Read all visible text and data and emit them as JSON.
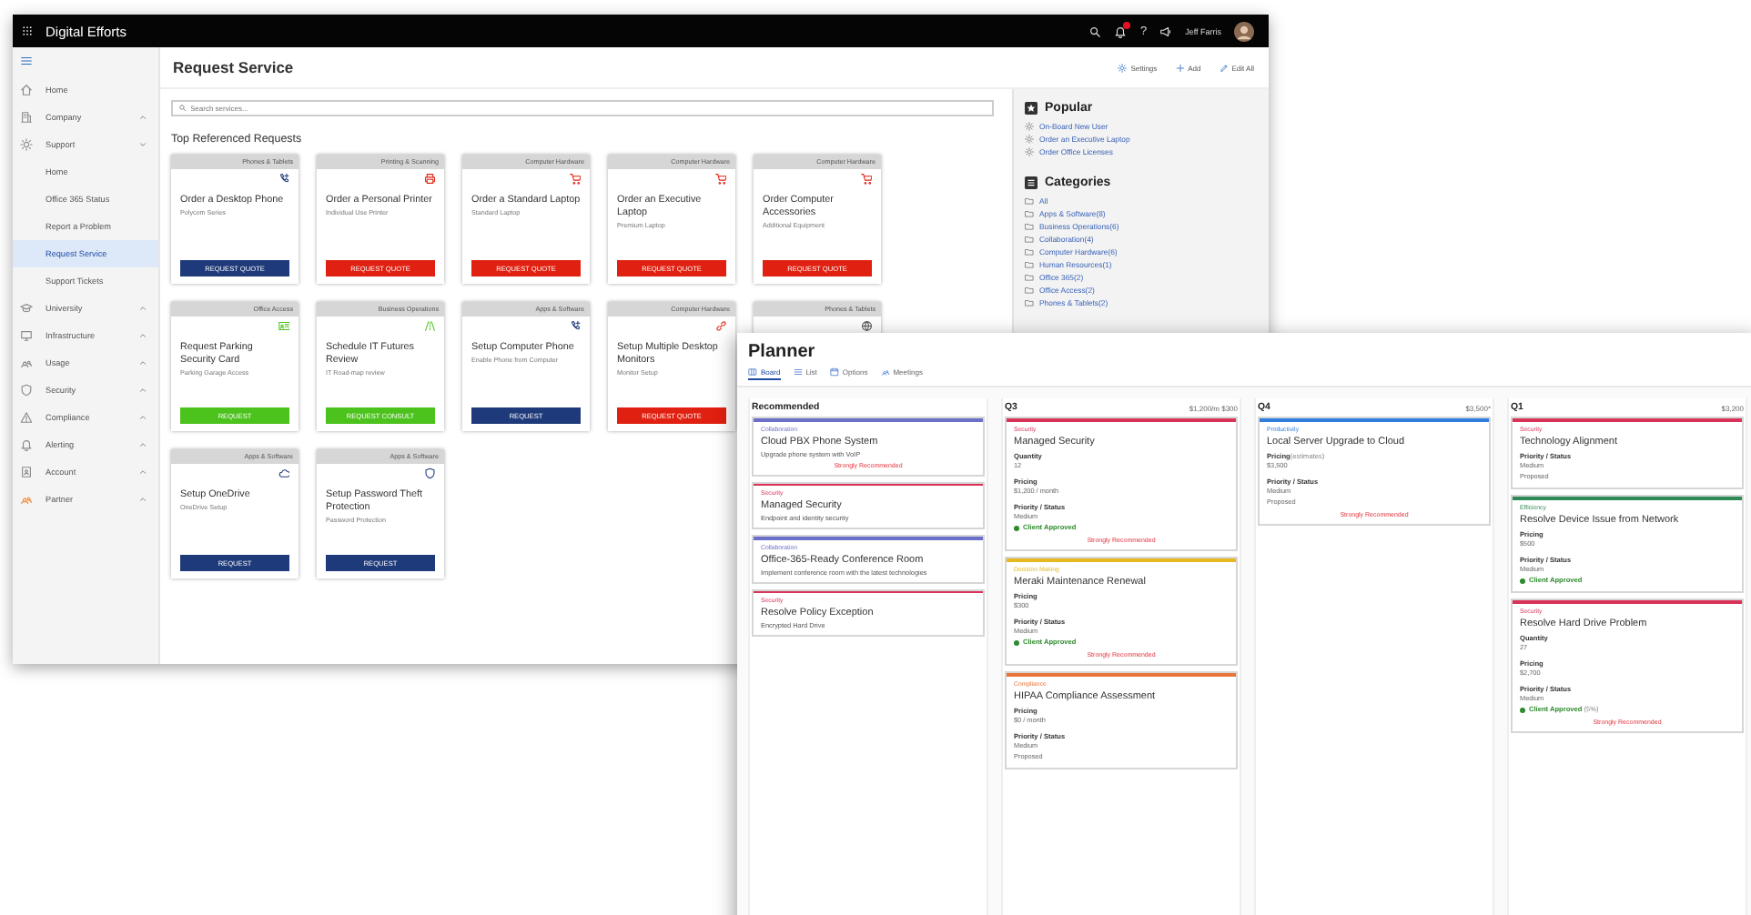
{
  "app": {
    "title": "Digital Efforts",
    "has_unread": true,
    "help": "?",
    "user": "Jeff Farris"
  },
  "sidebar": {
    "items": [
      {
        "label": "Home"
      },
      {
        "label": "Company",
        "expanded": false
      },
      {
        "label": "Support",
        "expanded": true,
        "children": [
          {
            "label": "Home",
            "selected": false
          },
          {
            "label": "Office 365 Status",
            "selected": false
          },
          {
            "label": "Report a Problem",
            "selected": false
          },
          {
            "label": "Request Service",
            "selected": true
          },
          {
            "label": "Support Tickets",
            "selected": false
          }
        ]
      },
      {
        "label": "University",
        "expanded": false
      },
      {
        "label": "Infrastructure",
        "expanded": false
      },
      {
        "label": "Usage",
        "expanded": false
      },
      {
        "label": "Security",
        "expanded": false
      },
      {
        "label": "Compliance",
        "expanded": false
      },
      {
        "label": "Alerting",
        "expanded": false
      },
      {
        "label": "Account",
        "expanded": false
      },
      {
        "label": "Partner",
        "expanded": false
      }
    ]
  },
  "main": {
    "title": "Request Service",
    "actions": [
      {
        "label": "Settings"
      },
      {
        "label": "Add"
      },
      {
        "label": "Edit All"
      }
    ],
    "search": {
      "placeholder": "Search services..."
    },
    "section_title": "Top Referenced Requests",
    "cards": [
      {
        "category": "Phones & Tablets",
        "title": "Order a Desktop Phone",
        "subtitle": "Polycom Series",
        "button": "REQUEST QUOTE",
        "color": "#1f3a7a"
      },
      {
        "category": "Printing & Scanning",
        "title": "Order a Personal Printer",
        "subtitle": "Individual Use Printer",
        "button": "REQUEST QUOTE",
        "color": "#e02010"
      },
      {
        "category": "Computer Hardware",
        "title": "Order a Standard Laptop",
        "subtitle": "Standard Laptop",
        "button": "REQUEST QUOTE",
        "color": "#e02010"
      },
      {
        "category": "Computer Hardware",
        "title": "Order an Executive Laptop",
        "subtitle": "Premium Laptop",
        "button": "REQUEST QUOTE",
        "color": "#e02010"
      },
      {
        "category": "Computer Hardware",
        "title": "Order Computer Accessories",
        "subtitle": "Additional Equipment",
        "button": "REQUEST QUOTE",
        "color": "#e02010"
      },
      {
        "category": "Office Access",
        "title": "Request Parking Security Card",
        "subtitle": "Parking Garage Access",
        "button": "REQUEST",
        "color": "#4cc21c"
      },
      {
        "category": "Business Operations",
        "title": "Schedule IT Futures Review",
        "subtitle": "IT Road-map review",
        "button": "REQUEST CONSULT",
        "color": "#4cc21c"
      },
      {
        "category": "Apps & Software",
        "title": "Setup Computer Phone",
        "subtitle": "Enable Phone from Computer",
        "button": "REQUEST",
        "color": "#1f3a7a"
      },
      {
        "category": "Computer Hardware",
        "title": "Setup Multiple Desktop Monitors",
        "subtitle": "Monitor Setup",
        "button": "REQUEST QUOTE",
        "color": "#e02010"
      },
      {
        "category": "Phones & Tablets"
      },
      {
        "category": "Apps & Software",
        "title": "Setup OneDrive",
        "subtitle": "OneDrive Setup",
        "button": "REQUEST",
        "color": "#1f3a7a"
      },
      {
        "category": "Apps & Software",
        "title": "Setup Password Theft Protection",
        "subtitle": "Password Protection",
        "button": "REQUEST",
        "color": "#1f3a7a"
      }
    ]
  },
  "aside": {
    "popular": {
      "title": "Popular",
      "items": [
        "On-Board New User",
        "Order an Executive Laptop",
        "Order Office Licenses"
      ]
    },
    "categories": {
      "title": "Categories",
      "items": [
        {
          "label": "All"
        },
        {
          "label": "Apps & Software",
          "count": "(8)"
        },
        {
          "label": "Business Operations",
          "count": "(6)"
        },
        {
          "label": "Collaboration",
          "count": "(4)"
        },
        {
          "label": "Computer Hardware",
          "count": "(6)"
        },
        {
          "label": "Human Resources",
          "count": "(1)"
        },
        {
          "label": "Office 365",
          "count": "(2)"
        },
        {
          "label": "Office Access",
          "count": "(2)"
        },
        {
          "label": "Phones & Tablets",
          "count": "(2)"
        }
      ]
    }
  },
  "planner": {
    "title": "Planner",
    "tabs": [
      {
        "label": "Board",
        "selected": true
      },
      {
        "label": "List",
        "selected": false
      },
      {
        "label": "Options",
        "selected": false
      },
      {
        "label": "Meetings",
        "selected": false
      }
    ],
    "columns": [
      {
        "title": "Recommended",
        "cards": [
          {
            "tag": "Collaboration",
            "color": "#6b6fc9",
            "title": "Cloud PBX Phone System",
            "subtitle": "Upgrade phone system with VoIP",
            "note": "Strongly Recommended"
          },
          {
            "tag": "Security",
            "color": "#d9335a",
            "title": "Managed Security",
            "subtitle": "Endpoint and identity security"
          },
          {
            "tag": "Collaboration",
            "color": "#6b6fc9",
            "title": "Office-365-Ready Conference Room",
            "subtitle": "Implement conference room with the latest technologies"
          },
          {
            "tag": "Security",
            "color": "#d9335a",
            "title": "Resolve Policy Exception",
            "subtitle": "Encrypted Hard Drive"
          }
        ]
      },
      {
        "title": "Q3",
        "total": "$1,200/m $300",
        "cards": [
          {
            "tag": "Security",
            "color": "#d9335a",
            "title": "Managed Security",
            "fields": [
              {
                "label": "Quantity",
                "values": [
                  "12"
                ]
              },
              {
                "label": "Pricing",
                "values": [
                  "$1,200 / month"
                ]
              },
              {
                "label": "Priority / Status",
                "values": [
                  "Medium"
                ],
                "approved": "Client Approved"
              }
            ],
            "note": "Strongly Recommended"
          },
          {
            "tag": "Decision Making",
            "color": "#e8b820",
            "title": "Meraki Maintenance Renewal",
            "fields": [
              {
                "label": "Pricing",
                "values": [
                  "$300"
                ]
              },
              {
                "label": "Priority / Status",
                "values": [
                  "Medium"
                ],
                "approved": "Client Approved"
              }
            ],
            "note": "Strongly Recommended"
          },
          {
            "tag": "Compliance",
            "color": "#e8743a",
            "title": "HIPAA Compliance Assessment",
            "fields": [
              {
                "label": "Pricing",
                "values": [
                  "$0 / month"
                ]
              },
              {
                "label": "Priority / Status",
                "values": [
                  "Medium",
                  "Proposed"
                ]
              }
            ]
          }
        ]
      },
      {
        "title": "Q4",
        "total": "$3,500*",
        "cards": [
          {
            "tag": "Productivity",
            "color": "#2f7de1",
            "title": "Local Server Upgrade to Cloud",
            "fields": [
              {
                "label": "Pricing",
                "label_note": "(estimates)",
                "values": [
                  "$3,500"
                ]
              },
              {
                "label": "Priority / Status",
                "values": [
                  "Medium",
                  "Proposed"
                ]
              }
            ],
            "note": "Strongly Recommended"
          }
        ]
      },
      {
        "title": "Q1",
        "total": "$3,200",
        "cards": [
          {
            "tag": "Security",
            "color": "#d9335a",
            "title": "Technology Alignment",
            "fields": [
              {
                "label": "Priority / Status",
                "values": [
                  "Medium",
                  "Proposed"
                ]
              }
            ]
          },
          {
            "tag": "Efficiency",
            "color": "#2e8b57",
            "title": "Resolve Device Issue from Network",
            "fields": [
              {
                "label": "Pricing",
                "values": [
                  "$500"
                ]
              },
              {
                "label": "Priority / Status",
                "values": [
                  "Medium"
                ],
                "approved": "Client Approved"
              }
            ]
          },
          {
            "tag": "Security",
            "color": "#d9335a",
            "title": "Resolve Hard Drive Problem",
            "fields": [
              {
                "label": "Quantity",
                "values": [
                  "27"
                ]
              },
              {
                "label": "Pricing",
                "values": [
                  "$2,700"
                ]
              },
              {
                "label": "Priority / Status",
                "values": [
                  "Medium"
                ],
                "approved": "Client Approved",
                "approved_note": "(5%)"
              }
            ],
            "note": "Strongly Recommended"
          }
        ]
      }
    ]
  }
}
